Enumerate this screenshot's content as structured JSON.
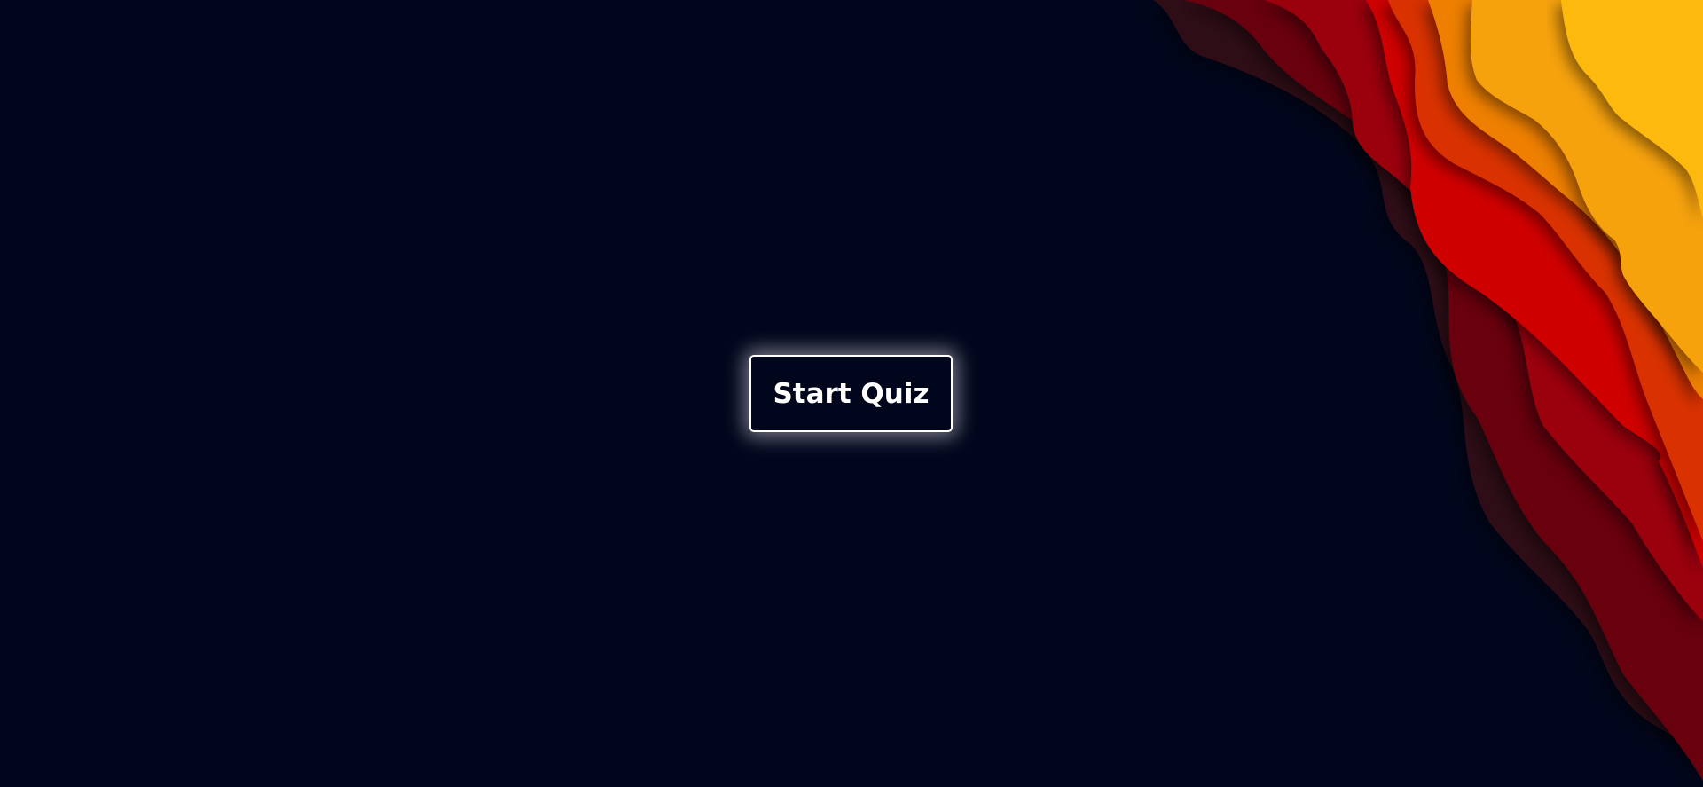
{
  "start_button": {
    "label": "Start Quiz"
  },
  "colors": {
    "background": "#01061c",
    "button_border": "#ffffff",
    "button_text": "#ffffff",
    "wave_layers": [
      "#2e0816",
      "#670510",
      "#9b0209",
      "#cf0002",
      "#d93002",
      "#ee7f04",
      "#f6a20a",
      "#fdb90c"
    ]
  },
  "decor": {
    "corner_waves": "layered-paper-waves"
  }
}
